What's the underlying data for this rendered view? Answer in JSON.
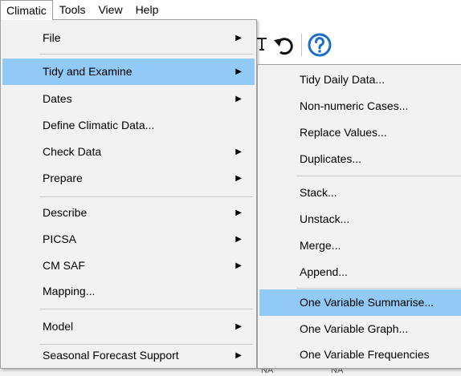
{
  "menubar": {
    "items": [
      "Climatic",
      "Tools",
      "View",
      "Help"
    ]
  },
  "bottom_strip": {
    "cells": [
      "NA",
      "NA"
    ]
  },
  "main_menu": {
    "items": [
      {
        "label": "File",
        "has_submenu": true
      },
      {
        "label": "Tidy and Examine",
        "has_submenu": true,
        "selected": true
      },
      {
        "label": "Dates",
        "has_submenu": true
      },
      {
        "label": "Define Climatic Data...",
        "has_submenu": false
      },
      {
        "label": "Check Data",
        "has_submenu": true
      },
      {
        "label": "Prepare",
        "has_submenu": true
      },
      {
        "label": "Describe",
        "has_submenu": true
      },
      {
        "label": "PICSA",
        "has_submenu": true
      },
      {
        "label": "CM SAF",
        "has_submenu": true
      },
      {
        "label": "Mapping...",
        "has_submenu": false
      },
      {
        "label": "Model",
        "has_submenu": true
      },
      {
        "label": "Seasonal Forecast Support",
        "has_submenu": true
      }
    ]
  },
  "submenu": {
    "items": [
      {
        "label": "Tidy Daily Data..."
      },
      {
        "label": "Non-numeric Cases..."
      },
      {
        "label": "Replace Values..."
      },
      {
        "label": "Duplicates..."
      },
      {
        "label": "Stack..."
      },
      {
        "label": "Unstack..."
      },
      {
        "label": "Merge..."
      },
      {
        "label": "Append..."
      },
      {
        "label": "One Variable Summarise...",
        "selected": true
      },
      {
        "label": "One Variable Graph..."
      },
      {
        "label": "One Variable Frequencies"
      }
    ]
  },
  "icons": {
    "arrow": "submenu-arrow-icon",
    "toolbar": [
      "pin-icon",
      "undo-icon",
      "help-icon"
    ]
  },
  "colors": {
    "highlight": "#91c9f7",
    "menu_bg": "#f2f2f2",
    "help_blue": "#1c6fc8"
  }
}
